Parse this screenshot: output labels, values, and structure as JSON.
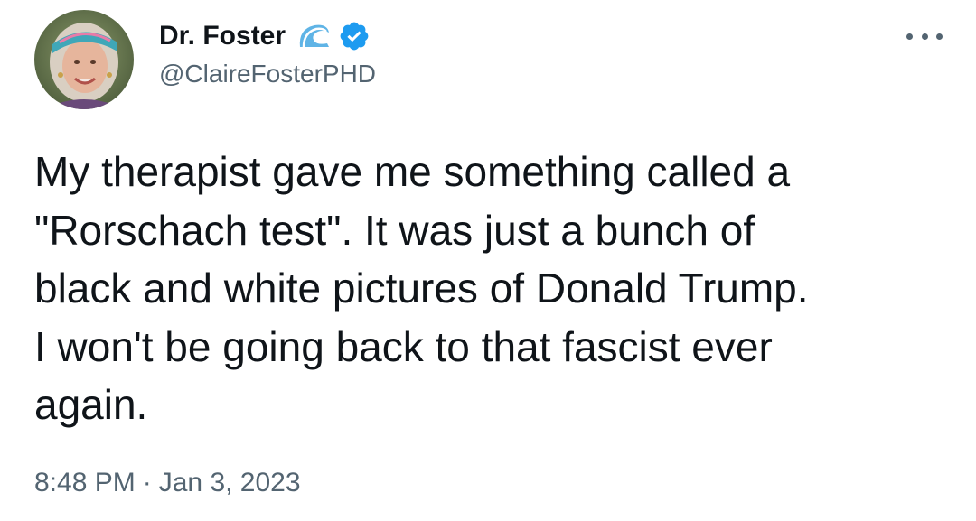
{
  "author": {
    "display_name": "Dr. Foster",
    "handle": "@ClaireFosterPHD",
    "badges": [
      "wave-emoji-icon",
      "verified-badge-icon"
    ],
    "avatar": "avatar-photo"
  },
  "tweet": {
    "text": "My therapist gave me something called a\n\"Rorschach test\". It was just a bunch of\nblack and white pictures of Donald Trump.\nI won't be going back to that fascist ever\nagain.",
    "time": "8:48 PM",
    "separator": "·",
    "date": "Jan 3, 2023"
  },
  "menu": {
    "icon": "more-options-icon"
  },
  "colors": {
    "text_primary": "#0f1419",
    "text_secondary": "#536471",
    "verified_blue": "#1d9bf0",
    "background": "#ffffff"
  }
}
